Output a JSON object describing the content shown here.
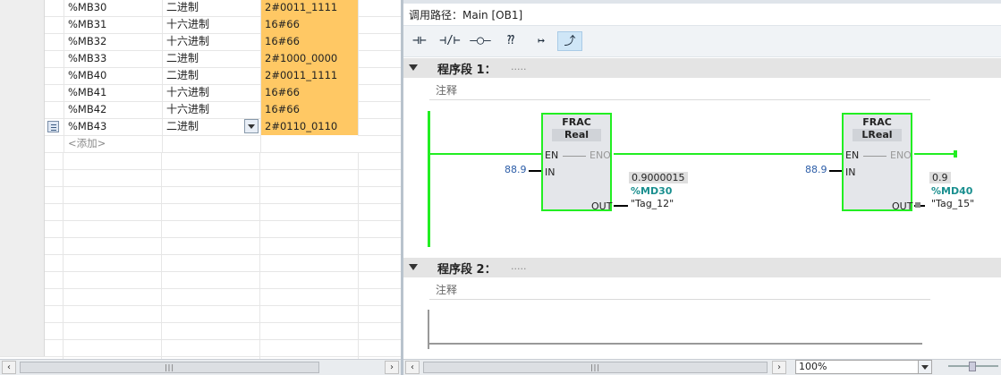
{
  "watch_table": {
    "rows": [
      {
        "address": "%MB30",
        "format": "二进制",
        "value": "2#0011_1111"
      },
      {
        "address": "%MB31",
        "format": "十六进制",
        "value": "16#66"
      },
      {
        "address": "%MB32",
        "format": "十六进制",
        "value": "16#66"
      },
      {
        "address": "%MB33",
        "format": "二进制",
        "value": "2#1000_0000"
      },
      {
        "address": "%MB40",
        "format": "二进制",
        "value": "2#0011_1111"
      },
      {
        "address": "%MB41",
        "format": "十六进制",
        "value": "16#66"
      },
      {
        "address": "%MB42",
        "format": "十六进制",
        "value": "16#66"
      },
      {
        "address": "%MB43",
        "format": "二进制",
        "value": "2#0110_0110"
      }
    ],
    "add_row_label": "<添加>",
    "selected_row_index": 7
  },
  "editor": {
    "call_path": "调用路径：Main [OB1]",
    "toolbar": [
      {
        "icon": "no-contact-icon",
        "glyph": "⊣⊢"
      },
      {
        "icon": "nc-contact-icon",
        "glyph": "⊣/⊢"
      },
      {
        "icon": "coil-icon",
        "glyph": "–◯–"
      },
      {
        "icon": "empty-box-icon",
        "glyph": "⁇"
      },
      {
        "icon": "open-branch-icon",
        "glyph": "↦"
      },
      {
        "icon": "close-branch-icon",
        "glyph": "⤴"
      }
    ],
    "networks": [
      {
        "title": "程序段 1：",
        "title_dots": ".....",
        "comment": "注释",
        "blocks": [
          {
            "name": "FRAC",
            "type": "Real",
            "en": "EN",
            "eno": "ENO",
            "in_label": "IN",
            "in_value": "88.9",
            "out_label": "OUT",
            "out_value": "0.9000015",
            "out_address": "%MD30",
            "out_tag": "\"Tag_12\""
          },
          {
            "name": "FRAC",
            "type": "LReal",
            "en": "EN",
            "eno": "ENO",
            "in_label": "IN",
            "in_value": "88.9",
            "out_label": "OUT",
            "out_value": "0.9",
            "out_address": "%MD40",
            "out_tag": "\"Tag_15\""
          }
        ]
      },
      {
        "title": "程序段 2：",
        "title_dots": ".....",
        "comment": "注释"
      }
    ],
    "zoom": "100%"
  },
  "colors": {
    "value_cell": "#ffc864",
    "power_flow": "#22ee22",
    "address_teal": "#1a8f8f",
    "input_value_blue": "#2d5ea8"
  }
}
